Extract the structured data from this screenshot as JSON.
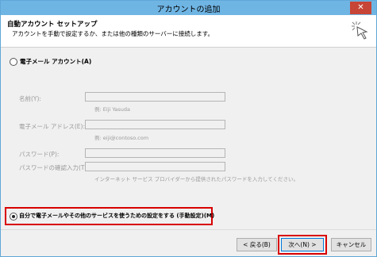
{
  "window": {
    "title": "アカウントの追加",
    "close_glyph": "✕"
  },
  "header": {
    "title": "自動アカウント セットアップ",
    "description": "アカウントを手動で設定するか、または他の種類のサーバーに接続します。"
  },
  "email_account_option": {
    "label": "電子メール アカウント(A)",
    "selected": false
  },
  "fields": {
    "name_label": "名前(Y):",
    "name_hint": "例: Eiji Yasuda",
    "email_label": "電子メール アドレス(E):",
    "email_hint": "例: eiji@contoso.com",
    "password_label": "パスワード(P):",
    "password_confirm_label": "パスワードの確認入力(T):",
    "password_hint": "インターネット サービス プロバイダーから提供されたパスワードを入力してください。"
  },
  "manual_option": {
    "label": "自分で電子メールやその他のサービスを使うための設定をする (手動設定)(M)",
    "selected": true
  },
  "buttons": {
    "back": "< 戻る(B)",
    "next": "次へ(N) >",
    "cancel": "キャンセル"
  },
  "colors": {
    "title_bar": "#6fb5e4",
    "close_button": "#c74536",
    "highlight": "#d90000"
  }
}
